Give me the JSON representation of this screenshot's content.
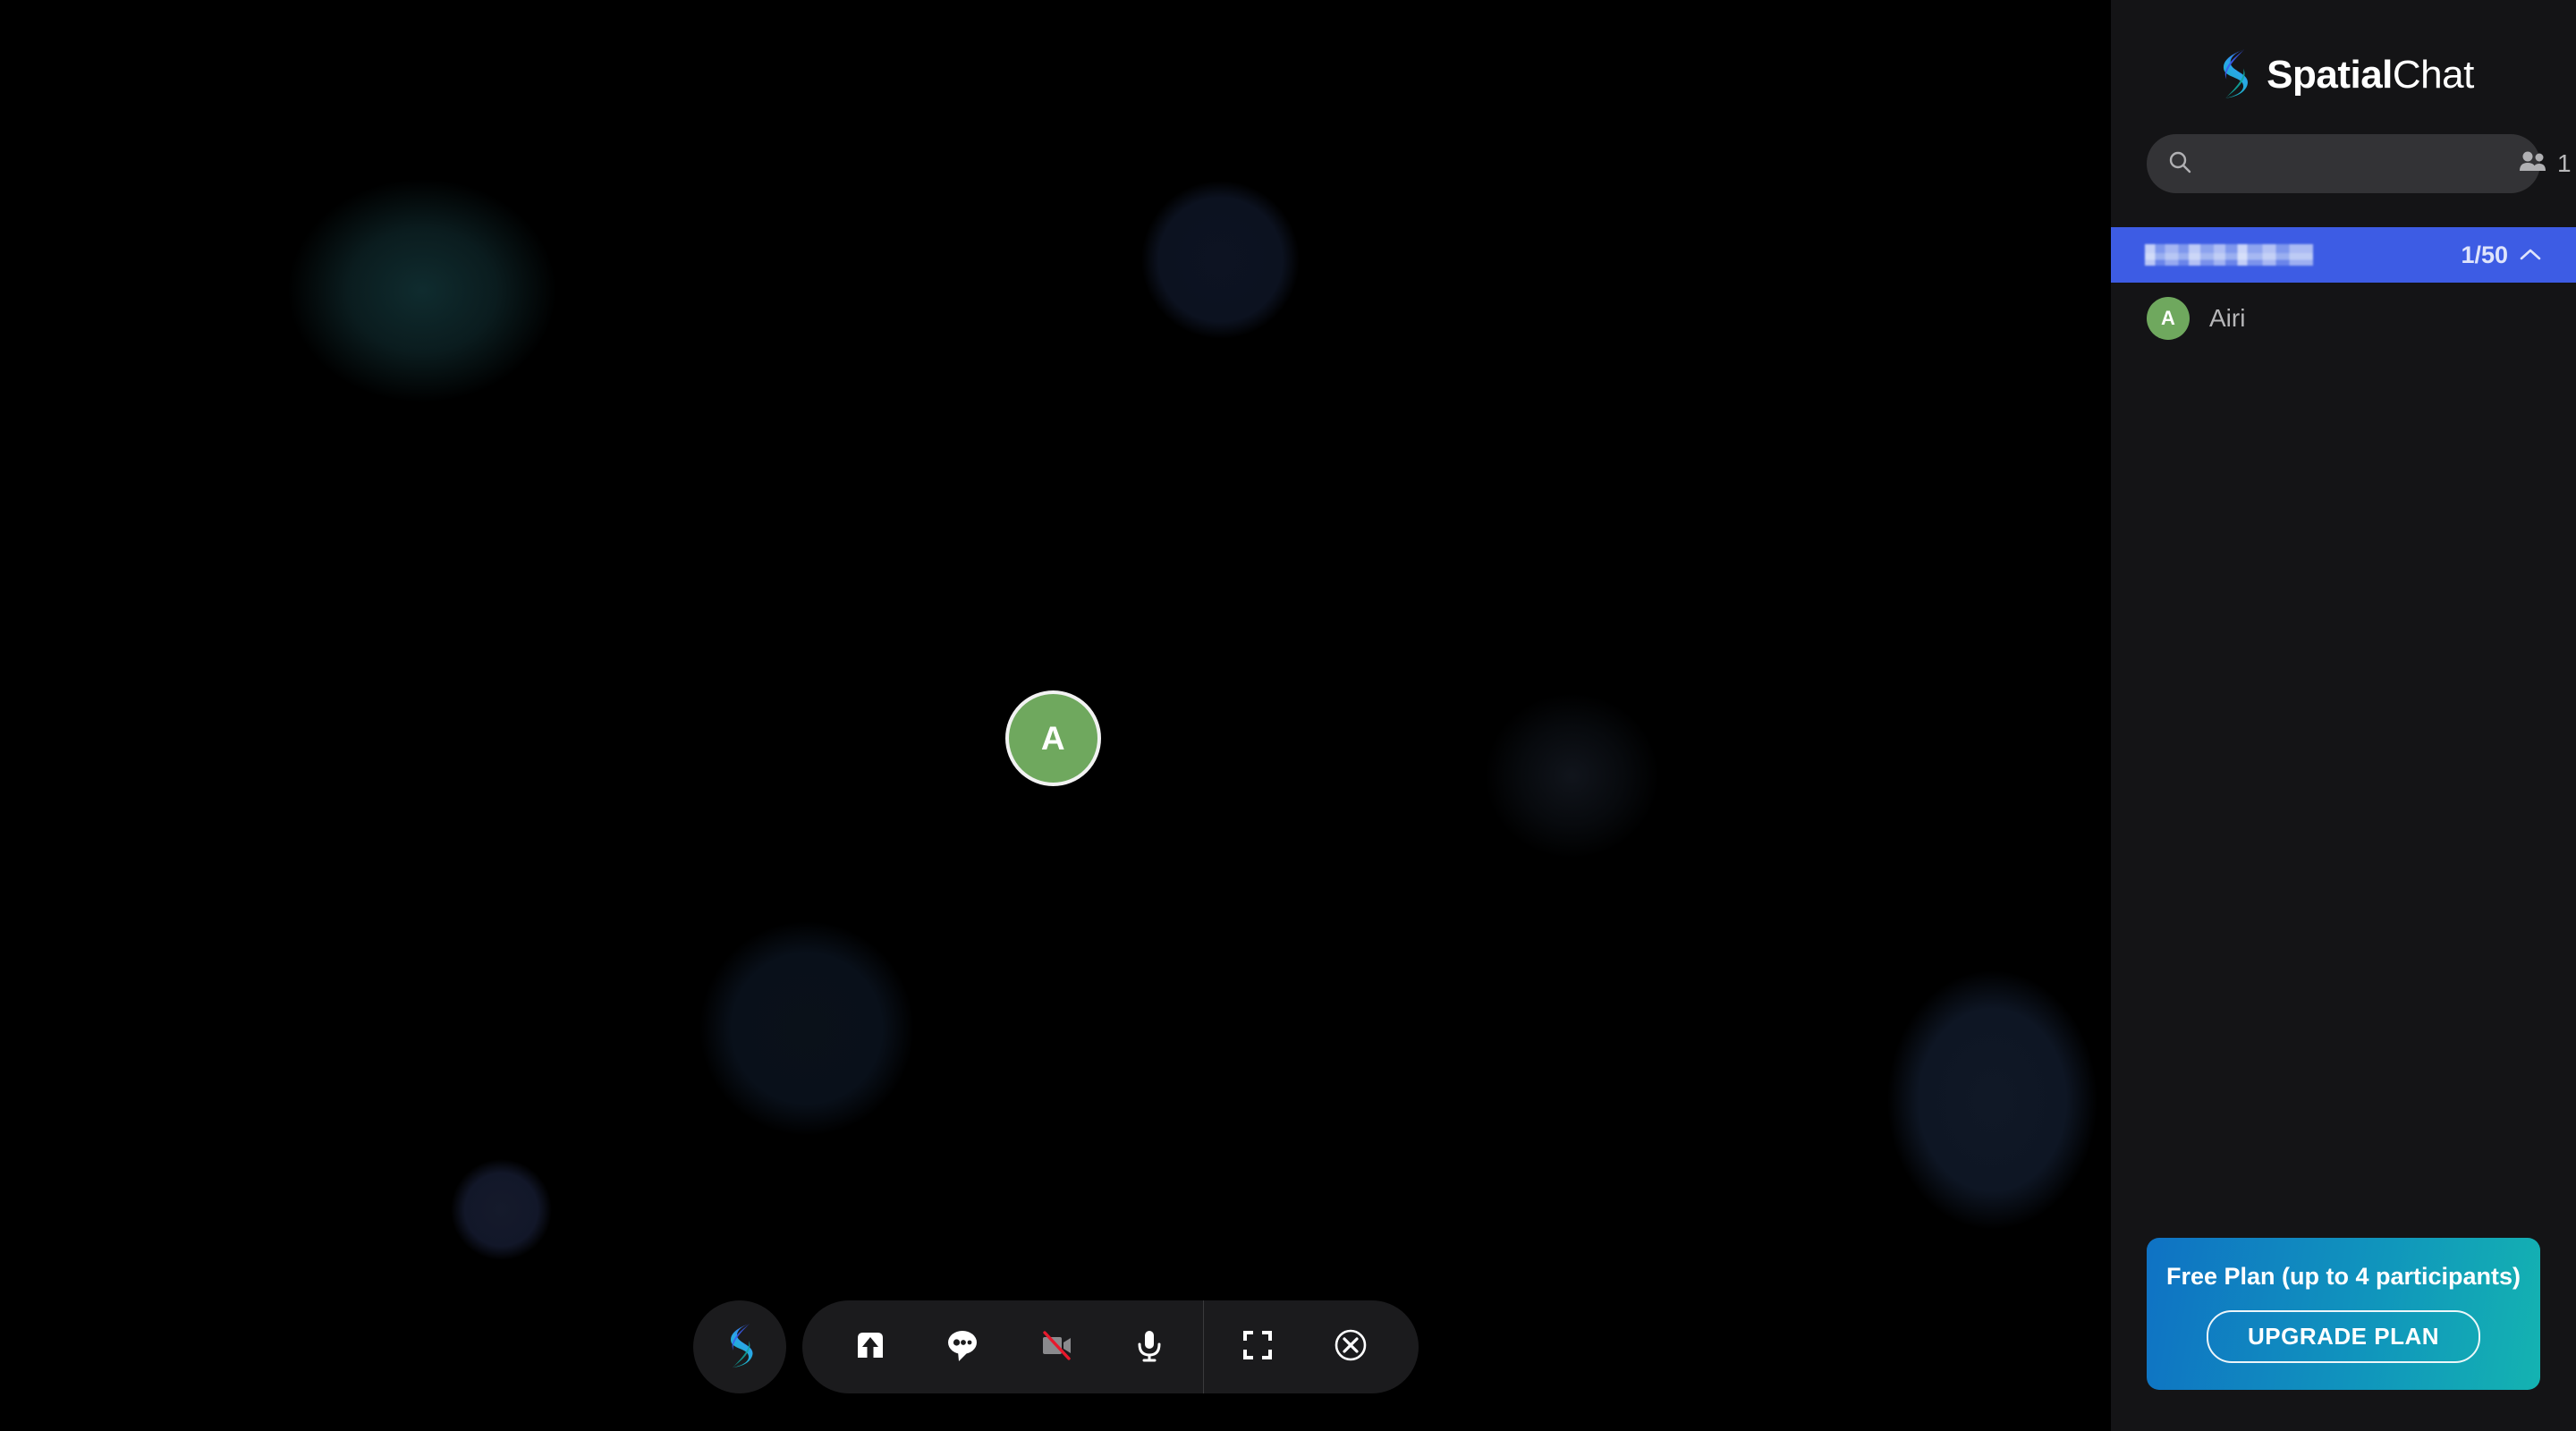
{
  "brand": {
    "name_bold": "Spatial",
    "name_light": "Chat",
    "logo_icon": "spatialchat-s-logo",
    "gradient_top": "#3b5bf0",
    "gradient_bottom": "#12b0ae"
  },
  "search": {
    "placeholder": "",
    "value": "",
    "icon": "search-icon",
    "people_icon": "people-icon",
    "people_count": "1"
  },
  "room": {
    "name": "",
    "name_state": "redacted",
    "capacity_label": "1/50",
    "collapse_icon": "chevron-up-icon",
    "header_color": "#3d5ce4"
  },
  "participants": [
    {
      "initial": "A",
      "name": "Airi",
      "avatar_color": "#6fa85e"
    }
  ],
  "canvas": {
    "self_avatar": {
      "initial": "A",
      "color": "#6fa85e",
      "ring_color": "#f2f2f2"
    }
  },
  "toolbar": {
    "logo_button": {
      "label": "SpatialChat menu",
      "icon": "spatialchat-s-logo"
    },
    "buttons": [
      {
        "name": "share-screen",
        "icon": "share-upload-icon",
        "label": "Share",
        "state": "enabled"
      },
      {
        "name": "chat",
        "icon": "chat-bubble-icon",
        "label": "Chat",
        "state": "enabled"
      },
      {
        "name": "camera",
        "icon": "camera-off-icon",
        "label": "Camera",
        "state": "off"
      },
      {
        "name": "microphone",
        "icon": "microphone-icon",
        "label": "Microphone",
        "state": "on"
      },
      {
        "name": "fullscreen",
        "icon": "fullscreen-icon",
        "label": "Fullscreen",
        "state": "enabled"
      },
      {
        "name": "leave",
        "icon": "close-circle-icon",
        "label": "Leave",
        "state": "enabled"
      }
    ]
  },
  "upgrade": {
    "title": "Free Plan (up to 4 participants)",
    "button_label": "UPGRADE PLAN",
    "gradient_from": "#0f72c4",
    "gradient_to": "#14b3b1"
  }
}
